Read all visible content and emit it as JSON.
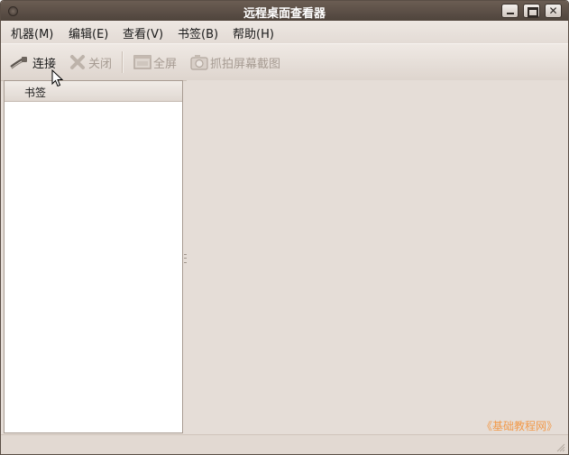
{
  "window": {
    "title": "远程桌面查看器",
    "controls": {
      "minimize": "minimize-icon",
      "maximize": "maximize-icon",
      "close": "close-icon"
    }
  },
  "menubar": {
    "items": [
      {
        "label": "机器(M)"
      },
      {
        "label": "编辑(E)"
      },
      {
        "label": "查看(V)"
      },
      {
        "label": "书签(B)"
      },
      {
        "label": "帮助(H)"
      }
    ]
  },
  "toolbar": {
    "items": [
      {
        "label": "连接",
        "icon": "connect-icon",
        "enabled": true
      },
      {
        "label": "关闭",
        "icon": "close-x-icon",
        "enabled": false
      },
      {
        "label": "全屏",
        "icon": "fullscreen-icon",
        "enabled": false
      },
      {
        "label": "抓拍屏幕截图",
        "icon": "camera-icon",
        "enabled": false
      }
    ]
  },
  "sidebar": {
    "header": "书签"
  },
  "watermark": "《基础教程网》",
  "colors": {
    "titlebar": "#4f443c",
    "watermark": "#f29a4a",
    "disabled_text": "#a69b92"
  }
}
